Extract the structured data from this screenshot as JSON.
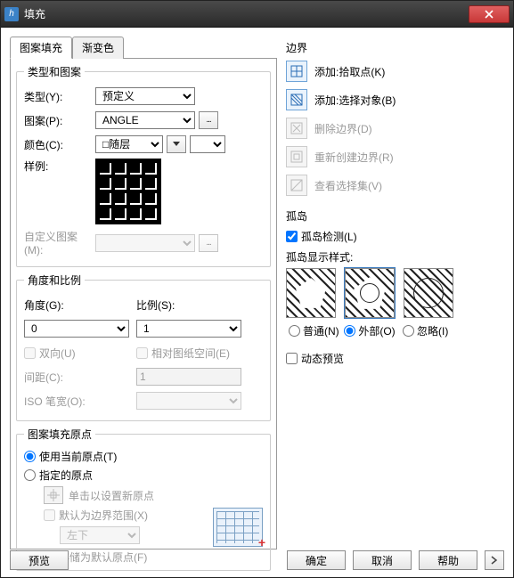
{
  "window": {
    "title": "填充"
  },
  "tabs": {
    "hatch": "图案填充",
    "gradient": "渐变色"
  },
  "type_pattern": {
    "legend": "类型和图案",
    "type_label": "类型(Y):",
    "type_value": "预定义",
    "pattern_label": "图案(P):",
    "pattern_value": "ANGLE",
    "color_label": "颜色(C):",
    "color_value": "随层",
    "sample_label": "样例:",
    "custom_label": "自定义图案(M):"
  },
  "angle_scale": {
    "legend": "角度和比例",
    "angle_label": "角度(G):",
    "scale_label": "比例(S):",
    "angle_value": "0",
    "scale_value": "1",
    "double_label": "双向(U)",
    "relpaper_label": "相对图纸空间(E)",
    "spacing_label": "间距(C):",
    "spacing_value": "1",
    "isowidth_label": "ISO 笔宽(O):"
  },
  "origin": {
    "legend": "图案填充原点",
    "use_current": "使用当前原点(T)",
    "specified": "指定的原点",
    "click_set": "单击以设置新原点",
    "default_extent": "默认为边界范围(X)",
    "pos_value": "左下",
    "store_default": "存储为默认原点(F)"
  },
  "boundary": {
    "legend": "边界",
    "add_pick": "添加:拾取点(K)",
    "add_select": "添加:选择对象(B)",
    "delete": "删除边界(D)",
    "recreate": "重新创建边界(R)",
    "view_sel": "查看选择集(V)"
  },
  "island": {
    "legend": "孤岛",
    "detect": "孤岛检测(L)",
    "style_label": "孤岛显示样式:",
    "normal": "普通(N)",
    "outer": "外部(O)",
    "ignore": "忽略(I)"
  },
  "dynamic_preview": "动态预览",
  "buttons": {
    "preview": "预览",
    "ok": "确定",
    "cancel": "取消",
    "help": "帮助"
  }
}
